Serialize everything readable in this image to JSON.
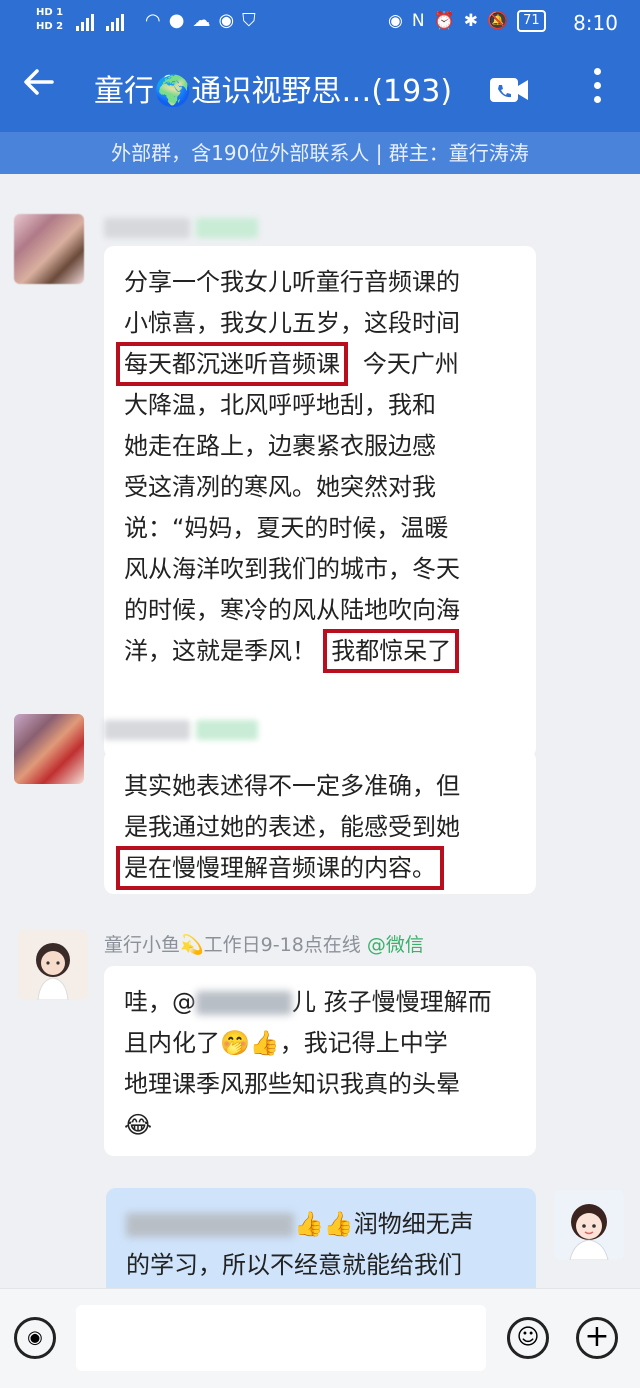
{
  "status_bar": {
    "hd1": "HD 1",
    "hd2": "HD 2",
    "battery": "71",
    "time": "8:10"
  },
  "header": {
    "back_icon": "arrow-left-icon",
    "title": "童行🌍通识视野思…(193)",
    "video_icon": "video-call-icon",
    "more_icon": "more-vertical-icon"
  },
  "group_info": "外部群，含190位外部联系人 | 群主：童行涛涛",
  "messages": [
    {
      "sender": "童行小鱼💫工作日9-18点在线",
      "source": "@微信",
      "lines": [
        "分享一个我女儿听童行音频课的",
        "小惊喜，我女儿五岁，这段时间",
        "每天都沉迷听音频课",
        "今天广州",
        "大降温，北风呼呼地刮，我和",
        "她走在路上，边裹紧衣服边感",
        "受这清冽的寒风。她突然对我",
        "说：“妈妈，夏天的时候，温暖",
        "风从海洋吹到我们的城市，冬天",
        "的时候，寒冷的风从陆地吹向海",
        "洋，这就是季风！",
        "我都惊呆了"
      ]
    },
    {
      "lines": [
        "其实她表述得不一定多准确，但",
        "是我通过她的表述，能感受到她",
        "是在慢慢理解音频课的内容。"
      ]
    },
    {
      "lines": [
        "哇，@",
        "儿 孩子慢慢理解而",
        "且内化了🤭👍，我记得上中学",
        "地理课季风那些知识我真的头晕",
        "😂"
      ]
    },
    {
      "lines": [
        "👍👍润物细无声",
        "的学习，所以不经意就能给我们"
      ]
    }
  ],
  "input_bar": {
    "voice_icon": "voice-input-icon",
    "emoji_icon": "emoji-icon",
    "plus_icon": "plus-icon"
  },
  "colors": {
    "header_bg": "#2d6fd2",
    "subbar_bg": "#4a83da",
    "highlight_box": "#b80f1e",
    "wechat_green": "#3bb06a",
    "my_bubble": "#cfe3fa"
  }
}
